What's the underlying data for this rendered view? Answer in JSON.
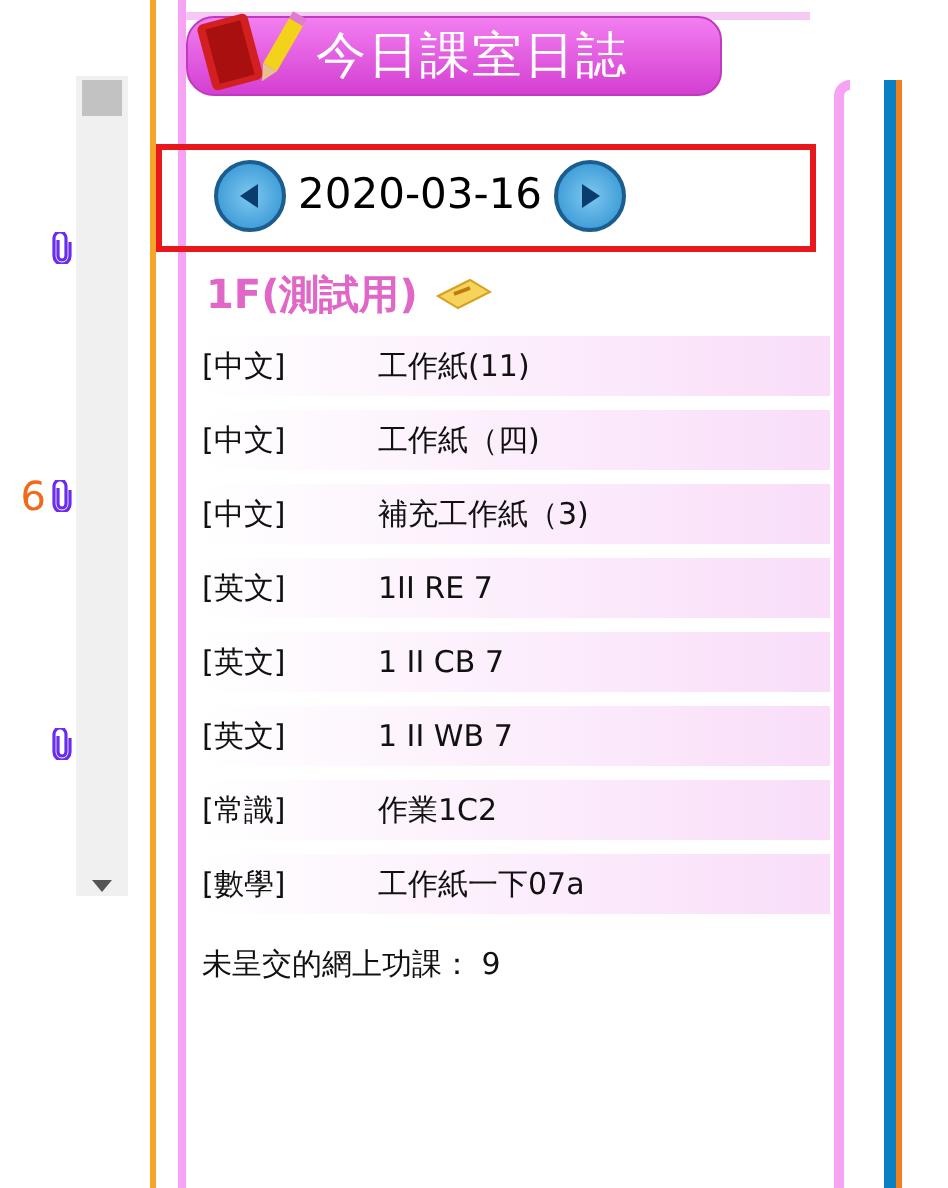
{
  "left_list": {
    "items": [
      {
        "attachment": true
      },
      {
        "text": "6",
        "attachment": true
      },
      {
        "attachment": true
      }
    ]
  },
  "panel": {
    "title": "今日課室日誌",
    "date": "2020-03-16",
    "class_name": "1F(測試用)",
    "entries": [
      {
        "subject": "[中文]",
        "task": "工作紙(11)"
      },
      {
        "subject": "[中文]",
        "task": "工作紙（四)"
      },
      {
        "subject": "[中文]",
        "task": "補充工作紙（3)"
      },
      {
        "subject": "[英文]",
        "task": "1II RE 7"
      },
      {
        "subject": "[英文]",
        "task": "1 II CB 7"
      },
      {
        "subject": "[英文]",
        "task": "1 II WB 7"
      },
      {
        "subject": "[常識]",
        "task": "作業1C2"
      },
      {
        "subject": "[數學]",
        "task": "工作紙一下07a"
      }
    ],
    "footer": "未呈交的網上功課： 9"
  }
}
